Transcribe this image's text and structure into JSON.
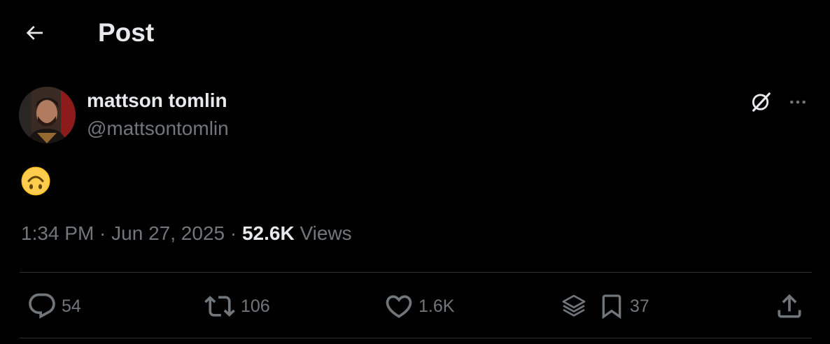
{
  "header": {
    "title": "Post"
  },
  "author": {
    "display_name": "mattson tomlin",
    "handle": "@mattsontomlin"
  },
  "post": {
    "text_emoji": "🙃",
    "time": "1:34 PM",
    "date": "Jun 27, 2025",
    "separator": " · ",
    "views_count": "52.6K",
    "views_label": "Views"
  },
  "actions": {
    "replies": "54",
    "reposts": "106",
    "likes": "1.6K",
    "bookmarks": "37"
  },
  "icons": [
    "back-arrow-icon",
    "grok-icon",
    "more-icon",
    "reply-icon",
    "repost-icon",
    "like-icon",
    "grok-layers-icon",
    "bookmark-icon",
    "share-icon"
  ],
  "colors": {
    "background": "#000000",
    "primary_text": "#e7e9ea",
    "secondary_text": "#71767b",
    "divider": "#2f3336"
  }
}
